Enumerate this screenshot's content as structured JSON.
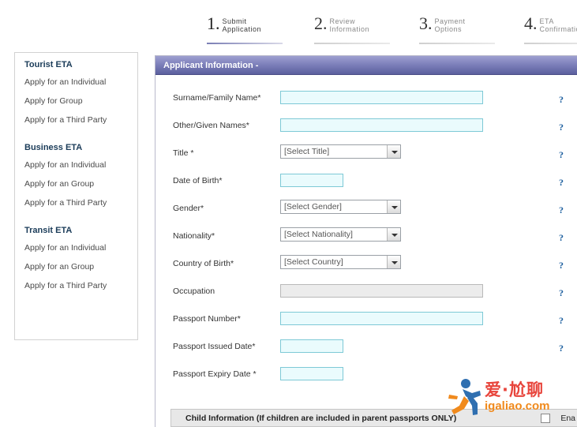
{
  "steps": [
    {
      "num": "1.",
      "line1": "Submit",
      "line2": "Application",
      "active": true
    },
    {
      "num": "2.",
      "line1": "Review",
      "line2": "Information",
      "active": false
    },
    {
      "num": "3.",
      "line1": "Payment",
      "line2": "Options",
      "active": false
    },
    {
      "num": "4.",
      "line1": "ETA",
      "line2": "Confirmation",
      "active": false
    }
  ],
  "sidebar": {
    "groups": [
      {
        "heading": "Tourist ETA",
        "items": [
          "Apply for an Individual",
          "Apply for Group",
          "Apply for a Third Party"
        ]
      },
      {
        "heading": "Business ETA",
        "items": [
          "Apply for an Individual",
          "Apply for an Group",
          "Apply for a Third Party"
        ]
      },
      {
        "heading": "Transit ETA",
        "items": [
          "Apply for an Individual",
          "Apply for an Group",
          "Apply for a Third Party"
        ]
      }
    ]
  },
  "panel": {
    "title": "Applicant Information -",
    "help_glyph": "?",
    "fields": [
      {
        "label": "Surname/Family Name*",
        "type": "text",
        "size": "wide",
        "value": ""
      },
      {
        "label": "Other/Given Names*",
        "type": "text",
        "size": "wide",
        "value": ""
      },
      {
        "label": "Title *",
        "type": "select",
        "value": "[Select Title]"
      },
      {
        "label": "Date of Birth*",
        "type": "text",
        "size": "narrow",
        "value": ""
      },
      {
        "label": "Gender*",
        "type": "select",
        "value": "[Select Gender]"
      },
      {
        "label": "Nationality*",
        "type": "select",
        "value": "[Select Nationality]"
      },
      {
        "label": "Country of Birth*",
        "type": "select",
        "value": "[Select Country]"
      },
      {
        "label": "Occupation",
        "type": "readonly",
        "value": ""
      },
      {
        "label": "Passport Number*",
        "type": "text",
        "size": "wide",
        "value": ""
      },
      {
        "label": "Passport Issued Date*",
        "type": "text",
        "size": "narrow",
        "value": ""
      },
      {
        "label": "Passport Expiry Date *",
        "type": "text",
        "size": "narrow",
        "value": ""
      }
    ]
  },
  "child_bar": {
    "label": "Child Information (If children are included in parent passports ONLY)",
    "toggle_label": "Ena"
  },
  "watermark": {
    "title": "爱·尬聊",
    "subtitle": "igaliao.com"
  },
  "colors": {
    "panel_header_from": "#9d9fd0",
    "panel_header_to": "#5b5f9e",
    "field_border": "#7ec9d6",
    "field_bg": "#eafbfd",
    "sidebar_heading": "#1b3c59",
    "watermark_red": "#e8453c",
    "watermark_orange": "#f08a1d"
  }
}
